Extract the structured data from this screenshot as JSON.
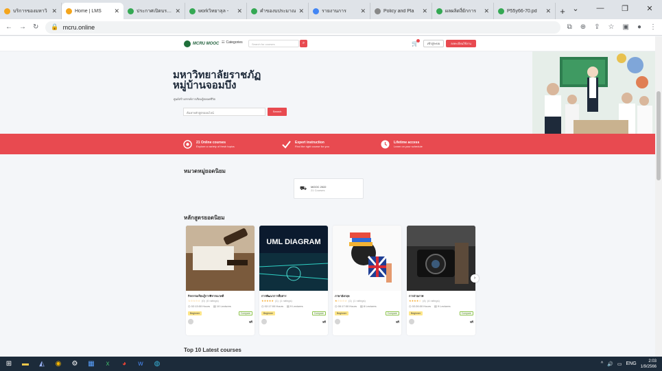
{
  "browser": {
    "tabs": [
      {
        "label": "บริการของมหาวิ",
        "color": "#f4a51c",
        "active": false
      },
      {
        "label": "Home | LMS",
        "color": "#f4a51c",
        "active": true
      },
      {
        "label": "ประกาศเปิดบรายวิ",
        "color": "#34a853",
        "active": false
      },
      {
        "label": "workวิทยาลุล - ",
        "color": "#34a853",
        "active": false
      },
      {
        "label": "คำของบประมาณ",
        "color": "#34a853",
        "active": false
      },
      {
        "label": "รายงานการ",
        "color": "#4285f4",
        "active": false
      },
      {
        "label": "Policy and Pla",
        "color": "#888888",
        "active": false
      },
      {
        "label": "ผลผลิตงี่ยักการ",
        "color": "#34a853",
        "active": false
      },
      {
        "label": "P55y66-70.pd",
        "color": "#34a853",
        "active": false
      }
    ],
    "new_tab": "+",
    "url": "mcru.online",
    "controls": {
      "dropdown": "⌄",
      "minimize": "—",
      "maximize": "❐",
      "close": "✕"
    }
  },
  "nav": {
    "logo_text": "MCRU MOOC",
    "categories_label": "Categories",
    "search_placeholder": "Search for courses",
    "login_label": "เข้าสู่ระบบ",
    "register_label": "ลงทะเบียนใช้งาน"
  },
  "hero": {
    "title_line1": "มหาวิทยาลัยราชภัฏ",
    "title_line2": "หมู่บ้านจอมบึง",
    "subtitle": "ศูนย์สร้างสรรค์การเรียนรู้ตลอดชีวิต",
    "search_placeholder": "ค้นหาหลักสูตรออนไลน์",
    "search_button": "Search"
  },
  "stats": [
    {
      "title": "21 Online courses",
      "desc": "Explore a variety of fresh topics",
      "icon": "target-icon"
    },
    {
      "title": "Expert instruction",
      "desc": "Find the right course for you",
      "icon": "check-icon"
    },
    {
      "title": "Lifetime access",
      "desc": "Learn on your schedule",
      "icon": "clock-icon"
    }
  ],
  "popular_categories": {
    "title": "หมวดหมู่ยอดนิยม",
    "items": [
      {
        "name": "MOOC 2022",
        "count": "21 Courses"
      }
    ]
  },
  "popular_courses": {
    "title": "หลักสูตรยอดนิยม",
    "items": [
      {
        "title": "กิจกรรมเรียนรู้การพิจารณาคดี",
        "stars": "☆☆☆☆☆",
        "rating": "(0)",
        "rating_count": "(0 ratings)",
        "hours": "02:13:00 Hours",
        "lectures": "10 Lectures",
        "level": "Beginner",
        "compare": "Compare",
        "price": "ฟรี",
        "thumb": "legal"
      },
      {
        "title": "การพัฒนาการสื่อสาร",
        "stars": "★★★★★",
        "rating": "(1)",
        "rating_count": "(1 ratings)",
        "hours": "02:17:00 Hours",
        "lectures": "9 Lectures",
        "level": "Beginner",
        "compare": "Compare",
        "price": "ฟรี",
        "thumb": "uml"
      },
      {
        "title": "ภาษาอังกฤษ",
        "stars": "★☆☆☆☆",
        "rating": "(1)",
        "rating_count": "(1 ratings)",
        "hours": "00:17:00 Hours",
        "lectures": "8 Lectures",
        "level": "Beginner",
        "compare": "Compare",
        "price": "ฟรี",
        "thumb": "books"
      },
      {
        "title": "การถ่ายภาพ",
        "stars": "★★★★☆",
        "rating": "(4)",
        "rating_count": "(4 ratings)",
        "hours": "02:26:00 Hours",
        "lectures": "9 Lectures",
        "level": "Beginner",
        "compare": "Compare",
        "price": "ฟรี",
        "thumb": "camera"
      }
    ]
  },
  "uml_thumb_text": "UML DIAGRAM",
  "latest_title": "Top 10 Latest courses",
  "taskbar": {
    "lang": "ENG",
    "time": "2:03",
    "date": "1/9/2566"
  }
}
